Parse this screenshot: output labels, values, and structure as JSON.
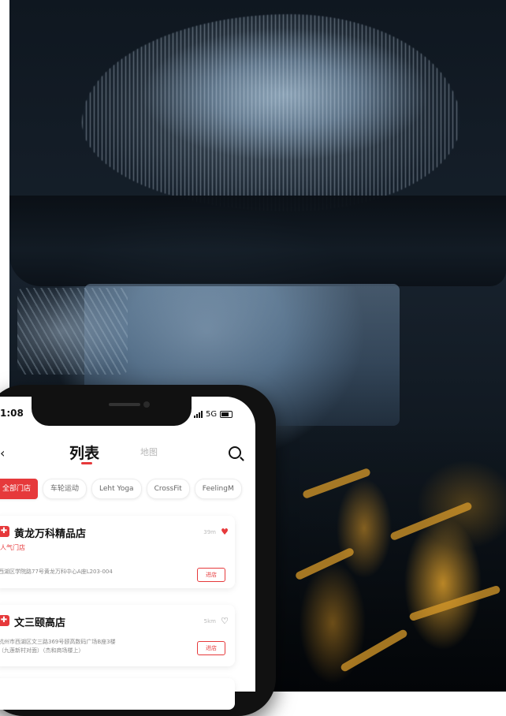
{
  "phone": {
    "status": {
      "time": "1:08",
      "network": "5G"
    },
    "header": {
      "tab_list": "列表",
      "tab_map": "地图"
    },
    "filters": [
      "全部门店",
      "车轮运动",
      "Leht Yoga",
      "CrossFit",
      "FeelingM"
    ],
    "stores": [
      {
        "name": "黄龙万科精品店",
        "tag": "人气门店",
        "distance": "39m",
        "favorite": true,
        "address": "西湖区学院路77号黄龙万科中心A座L203-004",
        "button": "进店"
      },
      {
        "name": "文三颐高店",
        "distance": "5km",
        "favorite": false,
        "address": "杭州市西湖区文三路369号颐高数码广场B座3楼\n（九莲新村对面）（杰和商场楼上）",
        "button": "进店"
      }
    ]
  },
  "colors": {
    "accent": "#e6393b",
    "background": "#ffffff"
  }
}
